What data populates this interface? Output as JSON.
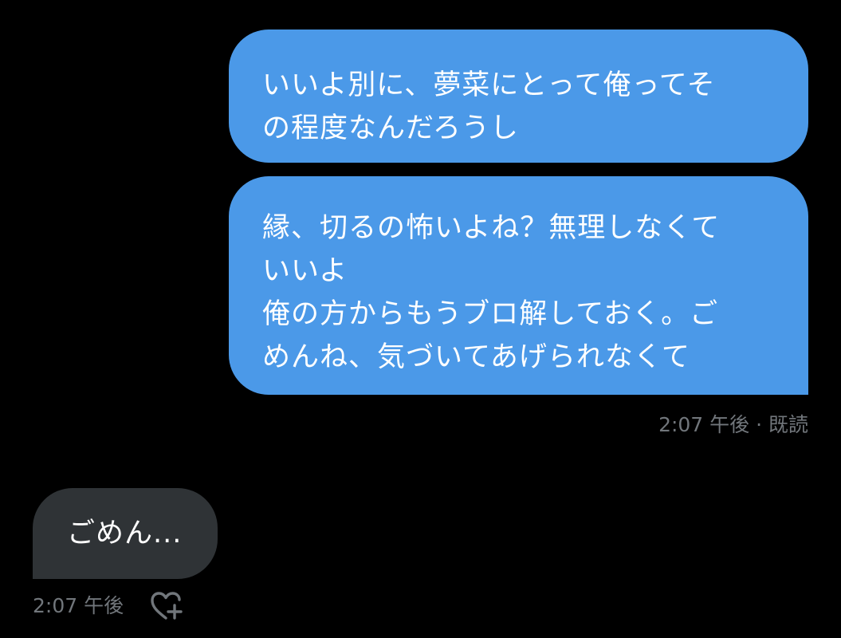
{
  "conversation": {
    "messages": [
      {
        "direction": "outgoing",
        "lines": [
          "いいよ別に、夢菜にとって俺ってそ",
          "の程度なんだろうし"
        ]
      },
      {
        "direction": "outgoing",
        "lines": [
          "縁、切るの怖いよね？無理しなくて",
          "いいよ",
          "俺の方からもうブロ解しておく。ご",
          "めんね、気づいてあげられなくて"
        ],
        "meta": "2:07 午後 · 既読"
      },
      {
        "direction": "incoming",
        "lines": [
          "ごめん..."
        ],
        "meta": "2:07 午後"
      }
    ],
    "like_icon": "heart-plus-icon"
  },
  "colors": {
    "background": "#000000",
    "outgoing_bubble": "#4b99e8",
    "incoming_bubble": "#2f3336",
    "meta_text": "#71767b"
  }
}
